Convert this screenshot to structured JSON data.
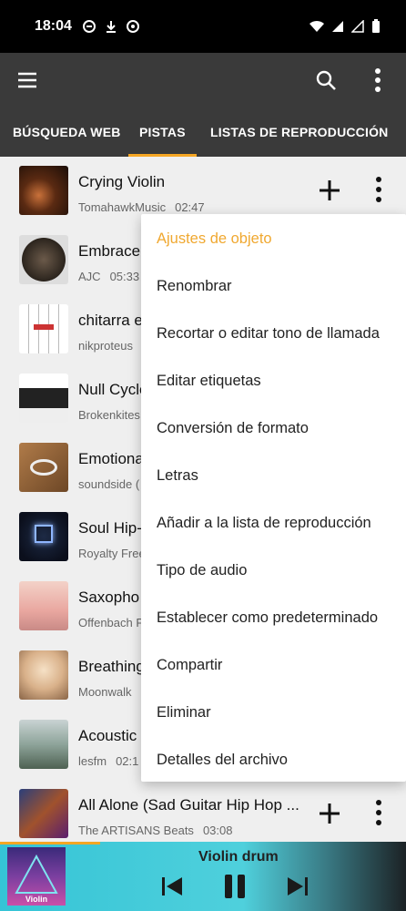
{
  "status_bar": {
    "time": "18:04"
  },
  "tabs": [
    {
      "label": "BÚSQUEDA WEB"
    },
    {
      "label": "PISTAS"
    },
    {
      "label": "LISTAS DE REPRODUCCIÓN"
    }
  ],
  "accent_color": "#f5a623",
  "tracks": [
    {
      "title": "Crying Violin",
      "artist": "TomahawkMusic",
      "duration": "02:47"
    },
    {
      "title": "Embrace",
      "artist": "AJC",
      "duration": "05:33"
    },
    {
      "title": "chitarra e",
      "artist": "nikproteus",
      "duration": ""
    },
    {
      "title": "Null Cycle",
      "artist": "Brokenkites",
      "duration": ""
    },
    {
      "title": "Emotiona",
      "artist": "soundside (",
      "duration": ""
    },
    {
      "title": "Soul Hip-",
      "artist": "Royalty Free",
      "duration": ""
    },
    {
      "title": "Saxopho",
      "artist": "Offenbach P",
      "duration": ""
    },
    {
      "title": "Breathing",
      "artist": "Moonwalk",
      "duration": ""
    },
    {
      "title": "Acoustic",
      "artist": "lesfm",
      "duration": "02:1"
    },
    {
      "title": "All Alone (Sad Guitar Hip Hop ...",
      "artist": "The ARTISANS Beats",
      "duration": "03:08"
    }
  ],
  "context_menu": {
    "header": "Ajustes de objeto",
    "items": [
      "Renombrar",
      "Recortar o editar tono de llamada",
      "Editar etiquetas",
      "Conversión de formato",
      "Letras",
      "Añadir a la lista de reproducción",
      "Tipo de audio",
      "Establecer como predeterminado",
      "Compartir",
      "Eliminar",
      "Detalles del archivo"
    ]
  },
  "player": {
    "title": "Violin  drum",
    "art_label": "Violin"
  }
}
